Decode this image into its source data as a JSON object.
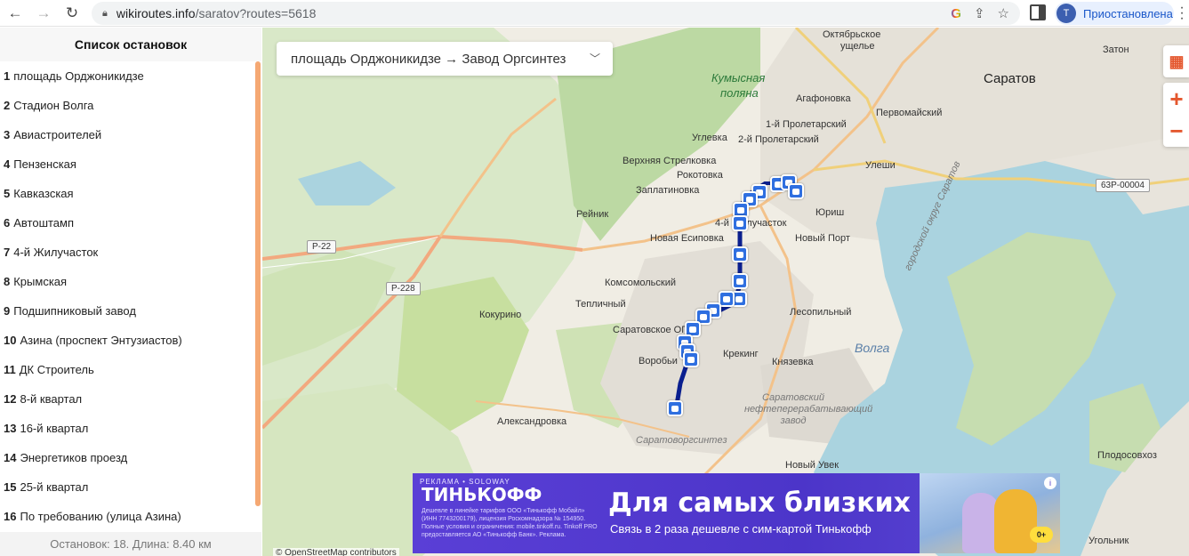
{
  "browser": {
    "url_domain": "wikiroutes.info",
    "url_path": "/saratov?routes=5618",
    "profile_initial": "T",
    "profile_label": "Приостановлена",
    "icons": [
      "back-arrow-icon",
      "forward-arrow-icon",
      "reload-icon",
      "lock-icon",
      "google-icon",
      "share-icon",
      "star-icon",
      "side-panel-icon",
      "menu-icon"
    ]
  },
  "sidebar": {
    "title": "Список остановок",
    "stops": [
      {
        "num": "1",
        "name": "площадь Орджоникидзе"
      },
      {
        "num": "2",
        "name": "Стадион Волга"
      },
      {
        "num": "3",
        "name": "Авиастроителей"
      },
      {
        "num": "4",
        "name": "Пензенская"
      },
      {
        "num": "5",
        "name": "Кавказская"
      },
      {
        "num": "6",
        "name": "Автоштамп"
      },
      {
        "num": "7",
        "name": "4-й Жилучасток"
      },
      {
        "num": "8",
        "name": "Крымская"
      },
      {
        "num": "9",
        "name": "Подшипниковый завод"
      },
      {
        "num": "10",
        "name": "Азина (проспект Энтузиастов)"
      },
      {
        "num": "11",
        "name": "ДК Строитель"
      },
      {
        "num": "12",
        "name": "8-й квартал"
      },
      {
        "num": "13",
        "name": "16-й квартал"
      },
      {
        "num": "14",
        "name": "Энергетиков проезд"
      },
      {
        "num": "15",
        "name": "25-й квартал"
      },
      {
        "num": "16",
        "name": "По требованию (улица Азина)"
      }
    ],
    "footer": "Остановок: 18. Длина: 8.40 км"
  },
  "map": {
    "route_select": "площадь Орджоникидзе → Завод Оргсинтез",
    "zoom_in": "+",
    "zoom_out": "−",
    "attribution": "© OpenStreetMap contributors",
    "labels": {
      "oktyabrskoe": "Октябрьское",
      "ushchelye": "ущелье",
      "zaton": "Затон",
      "kumysnaya": "Кумысная",
      "polyana": "поляна",
      "saratov": "Саратов",
      "agafonovka": "Агафоновка",
      "pervomaysky": "Первомайский",
      "proletarsky1": "1-й Пролетарский",
      "proletarsky2": "2-й Пролетарский",
      "uglevka": "Углевка",
      "verkh_strelkovka": "Верхняя Стрелковка",
      "rokotovka": "Рокотовка",
      "zaplatinovka": "Заплатиновка",
      "uleshi": "Улеши",
      "reynik": "Рейник",
      "zhiluchastok": "4-й Жилучасток",
      "yuriš": "Юриш",
      "novaya_esipovka": "Новая Есиповка",
      "novy_port": "Новый Порт",
      "komsomolsky": "Комсомольский",
      "teplichny": "Тепличный",
      "lesopilny": "Лесопильный",
      "kokurino": "Кокурино",
      "saratovskoe_opkh": "Саратовское ОПХ",
      "vorobyi": "Воробьи",
      "krekling": "Крекинг",
      "knyazevka": "Князевка",
      "volga": "Волга",
      "refinery": "Саратовский нефтеперерабатывающий завод",
      "aleksandrovka": "Александровка",
      "orgsintez": "Саратоворгсинтез",
      "novy_uvek": "Новый Увек",
      "plodosovkhoz": "Плодосовхоз",
      "ugolnik": "Угольник",
      "gorodskoy_okrug": "городской округ Саратов",
      "road_p22": "Р-22",
      "road_p228": "Р-228",
      "road_63r": "63Р-00004"
    }
  },
  "ad": {
    "tag": "РЕКЛАМА • SOLOWAY",
    "brand": "ТИНЬКОФФ",
    "legal": "Дешевле в линейке тарифов ООО «Тинькофф Мобайл» (ИНН 7743200179), лицензия Роскомнадзора № 154950. Полные условия и ограничения: mobile.tinkoff.ru. Tinkoff PRO предоставляется АО «Тинькофф Банк». Реклама.",
    "headline": "Для самых близких",
    "subline": "Связь в 2 раза дешевле с сим-картой Тинькофф",
    "badge": "0+",
    "accent": "#4c35c9"
  },
  "colors": {
    "sidebar_scroll": "#f5a873",
    "route_line": "#0a1f8f",
    "stop_marker": "#2f6fe0",
    "water": "#aad3df"
  }
}
